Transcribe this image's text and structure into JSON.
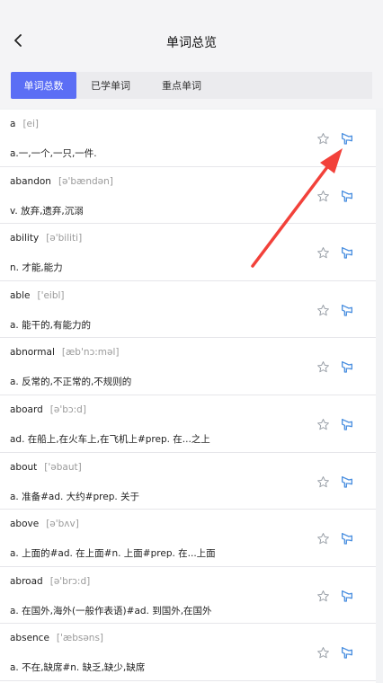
{
  "header": {
    "title": "单词总览"
  },
  "tabs": [
    {
      "label": "单词总数",
      "active": true
    },
    {
      "label": "已学单词",
      "active": false
    },
    {
      "label": "重点单词",
      "active": false
    }
  ],
  "words": [
    {
      "word": "a",
      "phonetic": "[ei]",
      "meaning": "a.一,一个,一只,一件."
    },
    {
      "word": "abandon",
      "phonetic": "[ə'bændən]",
      "meaning": "v. 放弃,遗弃,沉溺"
    },
    {
      "word": "ability",
      "phonetic": "[ə'biliti]",
      "meaning": "n. 才能,能力"
    },
    {
      "word": "able",
      "phonetic": "['eibl]",
      "meaning": "a. 能干的,有能力的"
    },
    {
      "word": "abnormal",
      "phonetic": "[æb'nɔ:məl]",
      "meaning": "a. 反常的,不正常的,不规则的"
    },
    {
      "word": "aboard",
      "phonetic": "[ə'bɔ:d]",
      "meaning": "ad. 在船上,在火车上,在飞机上#prep. 在...之上"
    },
    {
      "word": "about",
      "phonetic": "['əbaut]",
      "meaning": "a. 准备#ad. 大约#prep. 关于"
    },
    {
      "word": "above",
      "phonetic": "[ə'bʌv]",
      "meaning": "a. 上面的#ad. 在上面#n. 上面#prep. 在...上面"
    },
    {
      "word": "abroad",
      "phonetic": "[ə'brɔ:d]",
      "meaning": "a. 在国外,海外(一般作表语)#ad. 到国外,在国外"
    },
    {
      "word": "absence",
      "phonetic": "['æbsəns]",
      "meaning": "a. 不在,缺席#n. 缺乏,缺少,缺席"
    }
  ],
  "icons": {
    "back": "chevron-left-icon",
    "star": "star-outline-icon",
    "speaker": "speaker-icon",
    "annotation": "red-arrow-annotation"
  },
  "colors": {
    "accent": "#5b6ef5",
    "speaker": "#4a8fe0",
    "annotation": "#f2413a"
  }
}
